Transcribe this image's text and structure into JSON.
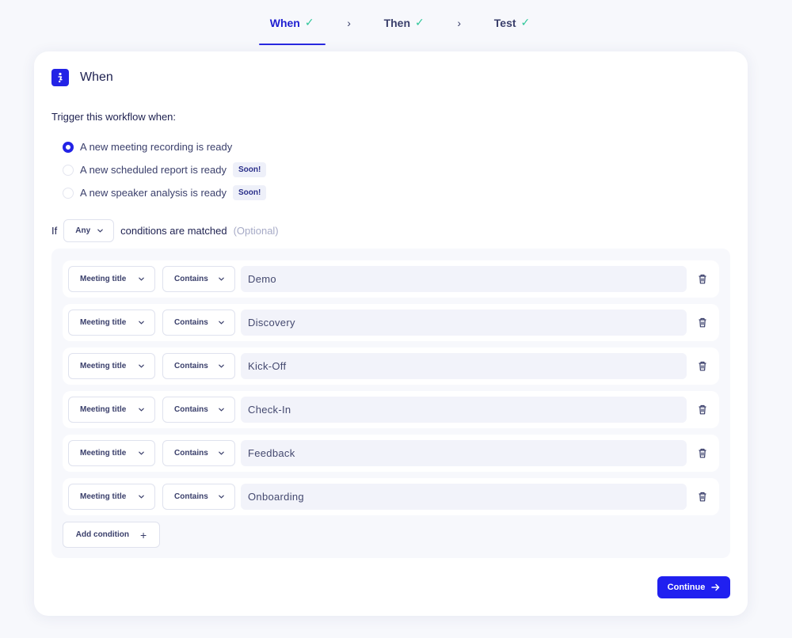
{
  "stepper": {
    "steps": [
      {
        "label": "When",
        "active": true
      },
      {
        "label": "Then",
        "active": false
      },
      {
        "label": "Test",
        "active": false
      }
    ],
    "separator": "›",
    "check": "✓"
  },
  "card": {
    "title": "When",
    "trigger_label": "Trigger this workflow when:",
    "triggers": [
      {
        "label": "A new meeting recording is ready",
        "checked": true,
        "badge": ""
      },
      {
        "label": "A new scheduled report is ready",
        "checked": false,
        "badge": "Soon!"
      },
      {
        "label": "A new speaker analysis is ready",
        "checked": false,
        "badge": "Soon!"
      }
    ],
    "if_prefix": "If",
    "match_mode": "Any",
    "if_suffix": "conditions are matched",
    "optional": "(Optional)",
    "conditions": [
      {
        "field": "Meeting title",
        "operator": "Contains",
        "value": "Demo"
      },
      {
        "field": "Meeting title",
        "operator": "Contains",
        "value": "Discovery"
      },
      {
        "field": "Meeting title",
        "operator": "Contains",
        "value": "Kick-Off"
      },
      {
        "field": "Meeting title",
        "operator": "Contains",
        "value": "Check-In"
      },
      {
        "field": "Meeting title",
        "operator": "Contains",
        "value": "Feedback"
      },
      {
        "field": "Meeting title",
        "operator": "Contains",
        "value": "Onboarding"
      }
    ],
    "add_condition_label": "Add condition",
    "add_condition_icon": "+",
    "continue_label": "Continue"
  },
  "colors": {
    "accent": "#2323e6",
    "check": "#2fc79a",
    "text": "#2b2f5e"
  },
  "icons": {
    "header": "workflow-icon",
    "trash": "trash-icon",
    "chevron": "chevron-down-icon",
    "arrow": "arrow-right-icon"
  }
}
